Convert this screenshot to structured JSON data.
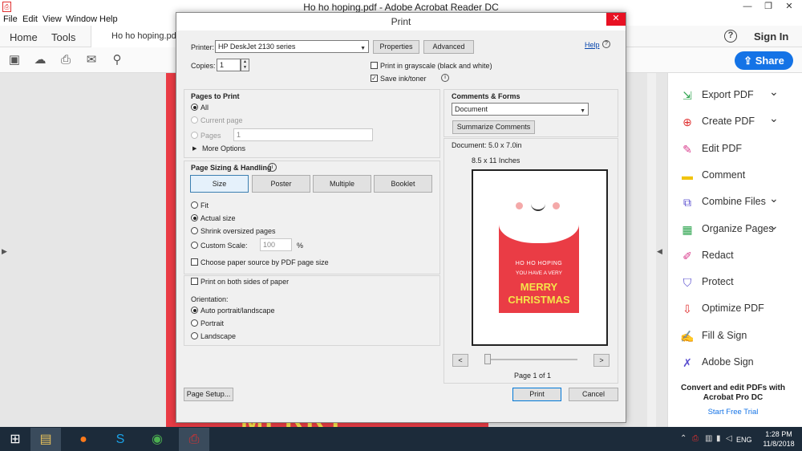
{
  "app": {
    "title": "Ho ho hoping.pdf - Adobe Acrobat Reader DC",
    "minimize": "—",
    "restore": "❐",
    "close": "✕"
  },
  "menu": [
    "File",
    "Edit",
    "View",
    "Window",
    "Help"
  ],
  "tabs": {
    "home": "Home",
    "tools": "Tools",
    "document": "Ho ho hoping.pdf"
  },
  "header": {
    "help": "?",
    "signin": "Sign In",
    "share": "Share"
  },
  "document": {
    "bottom_text": "MERRY"
  },
  "tools_pane": {
    "items": [
      {
        "label": "Export PDF",
        "icon": "export-pdf-icon",
        "color": "#2da44e",
        "chevron": true
      },
      {
        "label": "Create PDF",
        "icon": "create-pdf-icon",
        "color": "#e03030",
        "chevron": true
      },
      {
        "label": "Edit PDF",
        "icon": "edit-pdf-icon",
        "color": "#d83b8c",
        "chevron": false
      },
      {
        "label": "Comment",
        "icon": "comment-icon",
        "color": "#f1c40f",
        "chevron": false
      },
      {
        "label": "Combine Files",
        "icon": "combine-files-icon",
        "color": "#5a4fcf",
        "chevron": true
      },
      {
        "label": "Organize Pages",
        "icon": "organize-pages-icon",
        "color": "#2da44e",
        "chevron": true
      },
      {
        "label": "Redact",
        "icon": "redact-icon",
        "color": "#d83b8c",
        "chevron": false
      },
      {
        "label": "Protect",
        "icon": "protect-icon",
        "color": "#5a4fcf",
        "chevron": false
      },
      {
        "label": "Optimize PDF",
        "icon": "optimize-pdf-icon",
        "color": "#e03030",
        "chevron": false
      },
      {
        "label": "Fill & Sign",
        "icon": "fill-sign-icon",
        "color": "#5a4fcf",
        "chevron": false
      },
      {
        "label": "Adobe Sign",
        "icon": "adobe-sign-icon",
        "color": "#5a4fcf",
        "chevron": false
      }
    ],
    "promo": "Convert and edit PDFs with Acrobat Pro DC",
    "trial": "Start Free Trial"
  },
  "print_dialog": {
    "title": "Print",
    "printer_label": "Printer:",
    "printer_value": "HP DeskJet 2130 series",
    "properties": "Properties",
    "advanced": "Advanced",
    "help": "Help",
    "copies_label": "Copies:",
    "copies_value": "1",
    "grayscale": "Print in grayscale (black and white)",
    "save_ink": "Save ink/toner",
    "pages_to_print": {
      "heading": "Pages to Print",
      "all": "All",
      "current_page": "Current page",
      "pages": "Pages",
      "pages_value": "1",
      "more_options": "More Options"
    },
    "sizing": {
      "heading": "Page Sizing & Handling",
      "size": "Size",
      "poster": "Poster",
      "multiple": "Multiple",
      "booklet": "Booklet",
      "fit": "Fit",
      "actual_size": "Actual size",
      "shrink": "Shrink oversized pages",
      "custom_scale": "Custom Scale:",
      "custom_scale_value": "100",
      "percent": "%",
      "paper_source": "Choose paper source by PDF page size"
    },
    "both_sides": "Print on both sides of paper",
    "orientation": {
      "heading": "Orientation:",
      "auto": "Auto portrait/landscape",
      "portrait": "Portrait",
      "landscape": "Landscape"
    },
    "comments_forms": {
      "heading": "Comments & Forms",
      "value": "Document",
      "summarize": "Summarize Comments"
    },
    "preview": {
      "document_size": "Document: 5.0 x 7.0in",
      "paper_size": "8.5 x 11 Inches",
      "page_indicator": "Page 1 of 1",
      "card_line1": "HO HO HOPING",
      "card_line2": "YOU HAVE A VERY",
      "card_line3": "MERRY",
      "card_line4": "CHRISTMAS",
      "prev": "<",
      "next": ">"
    },
    "page_setup": "Page Setup...",
    "print": "Print",
    "cancel": "Cancel"
  },
  "taskbar": {
    "time": "1:28 PM",
    "date": "11/8/2018",
    "lang": "ENG"
  }
}
